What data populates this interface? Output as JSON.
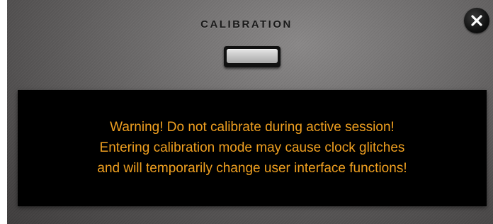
{
  "dialog": {
    "title": "CALIBRATION",
    "calibrate_button": {
      "label": ""
    },
    "close_button": {
      "icon": "close-icon"
    },
    "warning": {
      "lines": [
        "Warning! Do not calibrate during active session!",
        "Entering calibration mode may cause clock glitches",
        "and will temporarily change user interface functions!"
      ],
      "text_color": "#f0a020",
      "background_color": "#000000"
    }
  }
}
